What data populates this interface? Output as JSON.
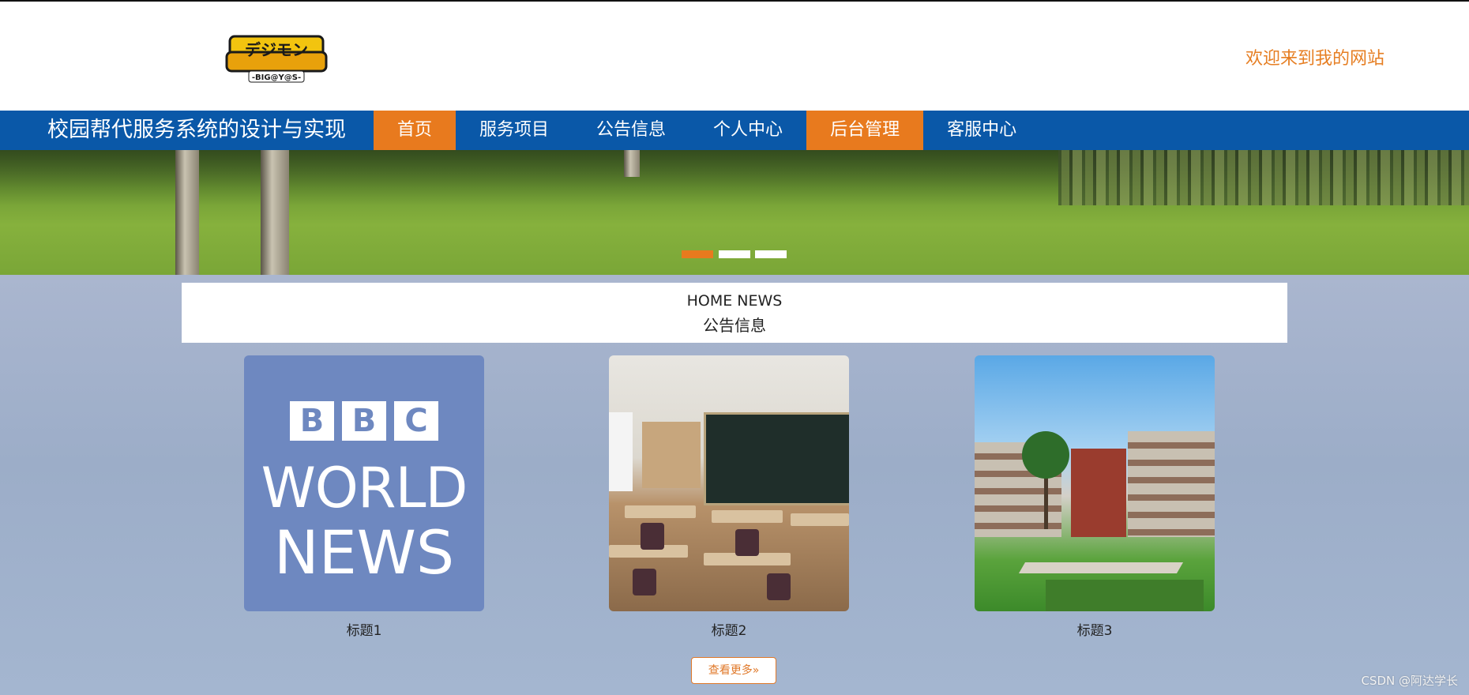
{
  "header": {
    "welcome_text": "欢迎来到我的网站",
    "logo_text_top": "デジモン",
    "logo_text_bottom": "-BIG@Y@S-"
  },
  "nav": {
    "site_title": "校园帮代服务系统的设计与实现",
    "items": [
      {
        "label": "首页",
        "active": true
      },
      {
        "label": "服务项目",
        "active": false
      },
      {
        "label": "公告信息",
        "active": false
      },
      {
        "label": "个人中心",
        "active": false
      },
      {
        "label": "后台管理",
        "active": true
      },
      {
        "label": "客服中心",
        "active": false
      }
    ]
  },
  "banner": {
    "slides_count": 3,
    "active_slide": 1
  },
  "news": {
    "heading_en": "HOME NEWS",
    "heading_cn": "公告信息",
    "cards": [
      {
        "title": "标题1",
        "thumb_letters": [
          "B",
          "B",
          "C"
        ],
        "thumb_line1": "WORLD",
        "thumb_line2": "NEWS"
      },
      {
        "title": "标题2"
      },
      {
        "title": "标题3"
      }
    ],
    "more_label": "查看更多»"
  },
  "watermark": "CSDN @阿达学长",
  "colors": {
    "accent": "#e87a1e",
    "nav_bg": "#0a58a8",
    "welcome": "#e67e22"
  }
}
